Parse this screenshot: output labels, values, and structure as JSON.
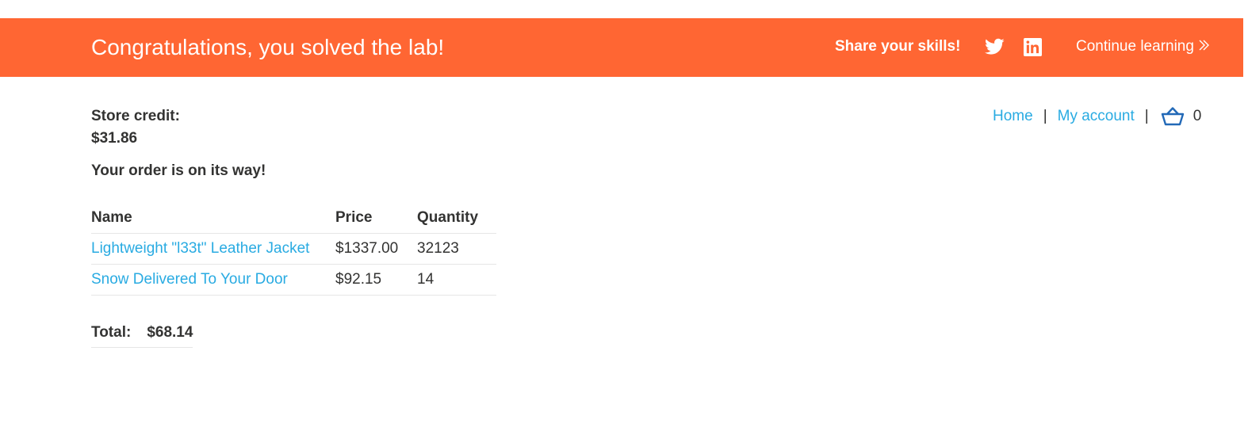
{
  "banner": {
    "title": "Congratulations, you solved the lab!",
    "share_label": "Share your skills!",
    "continue_label": "Continue learning",
    "background": "#ff6633",
    "icons": [
      "twitter-icon",
      "linkedin-icon",
      "chevrons-right-icon"
    ]
  },
  "nav": {
    "home": "Home",
    "separator": "|",
    "account": "My account",
    "cart_count": "0",
    "link_color": "#29abe2",
    "cart_icon": "basket-icon"
  },
  "account": {
    "store_credit_label": "Store credit:",
    "store_credit_value": "$31.86",
    "order_message": "Your order is on its way!"
  },
  "order": {
    "headers": {
      "name": "Name",
      "price": "Price",
      "quantity": "Quantity"
    },
    "rows": [
      {
        "name": "Lightweight \"l33t\" Leather Jacket",
        "price": "$1337.00",
        "quantity": "32123"
      },
      {
        "name": "Snow Delivered To Your Door",
        "price": "$92.15",
        "quantity": "14"
      }
    ],
    "total_label": "Total:",
    "total_value": "$68.14"
  }
}
